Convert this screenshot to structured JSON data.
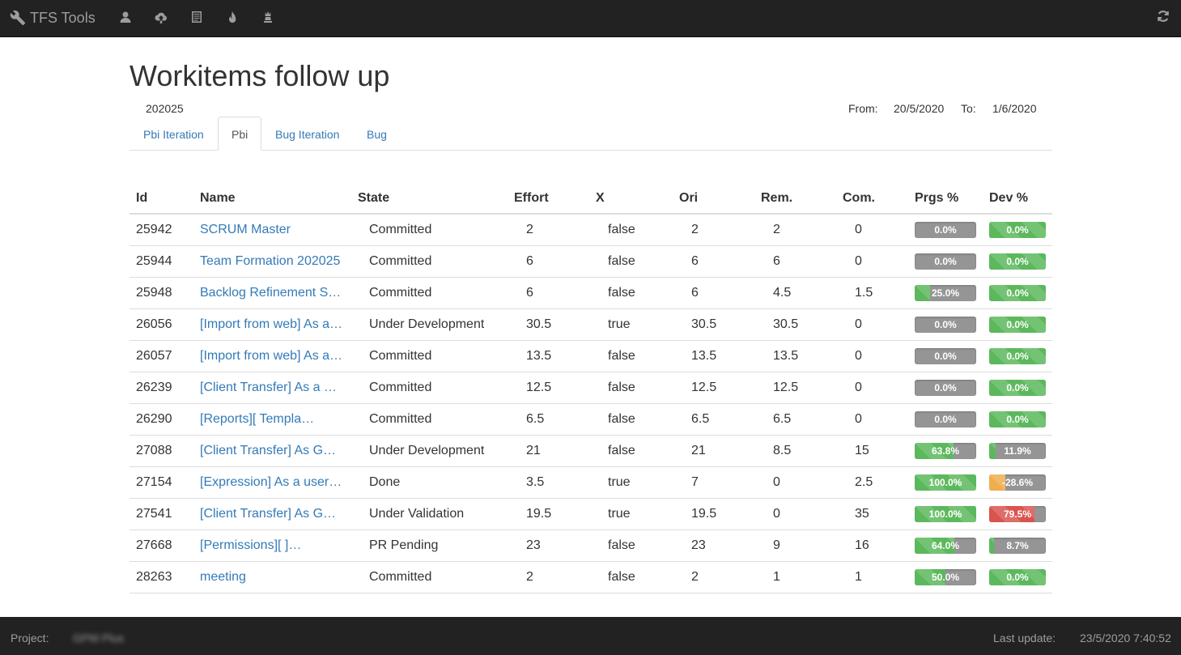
{
  "navbar": {
    "brand": "TFS Tools",
    "icons": [
      "user-icon",
      "cloud-upload-icon",
      "list-icon",
      "fire-icon",
      "queen-icon"
    ],
    "refresh_icon": "refresh-icon"
  },
  "header": {
    "title": "Workitems follow up",
    "iteration": "202025",
    "from_label": "From:",
    "from_value": "20/5/2020",
    "to_label": "To:",
    "to_value": "1/6/2020"
  },
  "tabs": [
    {
      "label": "Pbi Iteration",
      "active": false
    },
    {
      "label": "Pbi",
      "active": true
    },
    {
      "label": "Bug Iteration",
      "active": false
    },
    {
      "label": "Bug",
      "active": false
    }
  ],
  "table": {
    "columns": [
      "Id",
      "Name",
      "State",
      "Effort",
      "X",
      "Ori",
      "Rem.",
      "Com.",
      "Prgs %",
      "Dev %"
    ],
    "rows": [
      {
        "id": "25942",
        "name": "SCRUM Master",
        "state": "Committed",
        "effort": "2",
        "x": "false",
        "ori": "2",
        "rem": "2",
        "com": "0",
        "prgs": "0.0%",
        "prgs_value": 0,
        "dev": "0.0%",
        "dev_value": 0,
        "dev_status": "success"
      },
      {
        "id": "25944",
        "name": "Team Formation 202025",
        "state": "Committed",
        "effort": "6",
        "x": "false",
        "ori": "6",
        "rem": "6",
        "com": "0",
        "prgs": "0.0%",
        "prgs_value": 0,
        "dev": "0.0%",
        "dev_value": 0,
        "dev_status": "success"
      },
      {
        "id": "25948",
        "name": "Backlog Refinement S…",
        "state": "Committed",
        "effort": "6",
        "x": "false",
        "ori": "6",
        "rem": "4.5",
        "com": "1.5",
        "prgs": "25.0%",
        "prgs_value": 25,
        "dev": "0.0%",
        "dev_value": 0,
        "dev_status": "success"
      },
      {
        "id": "26056",
        "name": "[Import from web] As a…",
        "state": "Under Development",
        "effort": "30.5",
        "x": "true",
        "ori": "30.5",
        "rem": "30.5",
        "com": "0",
        "prgs": "0.0%",
        "prgs_value": 0,
        "dev": "0.0%",
        "dev_value": 0,
        "dev_status": "success"
      },
      {
        "id": "26057",
        "name": "[Import from web] As a…",
        "state": "Committed",
        "effort": "13.5",
        "x": "false",
        "ori": "13.5",
        "rem": "13.5",
        "com": "0",
        "prgs": "0.0%",
        "prgs_value": 0,
        "dev": "0.0%",
        "dev_value": 0,
        "dev_status": "success"
      },
      {
        "id": "26239",
        "name": "[Client Transfer] As a …",
        "state": "Committed",
        "effort": "12.5",
        "x": "false",
        "ori": "12.5",
        "rem": "12.5",
        "com": "0",
        "prgs": "0.0%",
        "prgs_value": 0,
        "dev": "0.0%",
        "dev_value": 0,
        "dev_status": "success"
      },
      {
        "id": "26290",
        "name": "[Reports][          Templa…",
        "state": "Committed",
        "effort": "6.5",
        "x": "false",
        "ori": "6.5",
        "rem": "6.5",
        "com": "0",
        "prgs": "0.0%",
        "prgs_value": 0,
        "dev": "0.0%",
        "dev_value": 0,
        "dev_status": "success"
      },
      {
        "id": "27088",
        "name": "[Client Transfer] As G…",
        "state": "Under Development",
        "effort": "21",
        "x": "false",
        "ori": "21",
        "rem": "8.5",
        "com": "15",
        "prgs": "63.8%",
        "prgs_value": 63.8,
        "dev": "11.9%",
        "dev_value": 11.9,
        "dev_status": "success"
      },
      {
        "id": "27154",
        "name": "[Expression] As a user…",
        "state": "Done",
        "effort": "3.5",
        "x": "true",
        "ori": "7",
        "rem": "0",
        "com": "2.5",
        "prgs": "100.0%",
        "prgs_value": 100,
        "dev": "-28.6%",
        "dev_value": 28.6,
        "dev_status": "warning"
      },
      {
        "id": "27541",
        "name": "[Client Transfer] As G…",
        "state": "Under Validation",
        "effort": "19.5",
        "x": "true",
        "ori": "19.5",
        "rem": "0",
        "com": "35",
        "prgs": "100.0%",
        "prgs_value": 100,
        "dev": "79.5%",
        "dev_value": 79.5,
        "dev_status": "danger"
      },
      {
        "id": "27668",
        "name": "[Permissions][             ]…",
        "state": "PR Pending",
        "effort": "23",
        "x": "false",
        "ori": "23",
        "rem": "9",
        "com": "16",
        "prgs": "64.0%",
        "prgs_value": 64,
        "dev": "8.7%",
        "dev_value": 8.7,
        "dev_status": "success"
      },
      {
        "id": "28263",
        "name": "                 meeting",
        "state": "Committed",
        "effort": "2",
        "x": "false",
        "ori": "2",
        "rem": "1",
        "com": "1",
        "prgs": "50.0%",
        "prgs_value": 50,
        "dev": "0.0%",
        "dev_value": 0,
        "dev_status": "success"
      }
    ]
  },
  "colors": {
    "success": "#5cb85c",
    "warning": "#f0ad4e",
    "danger": "#d9534f",
    "bar_track": "#959595",
    "link": "#337ab7",
    "navbar": "#222222"
  },
  "footer": {
    "project_label": "Project:",
    "project_value": "GPM Plus",
    "update_label": "Last update:",
    "update_value": "23/5/2020 7:40:52"
  }
}
